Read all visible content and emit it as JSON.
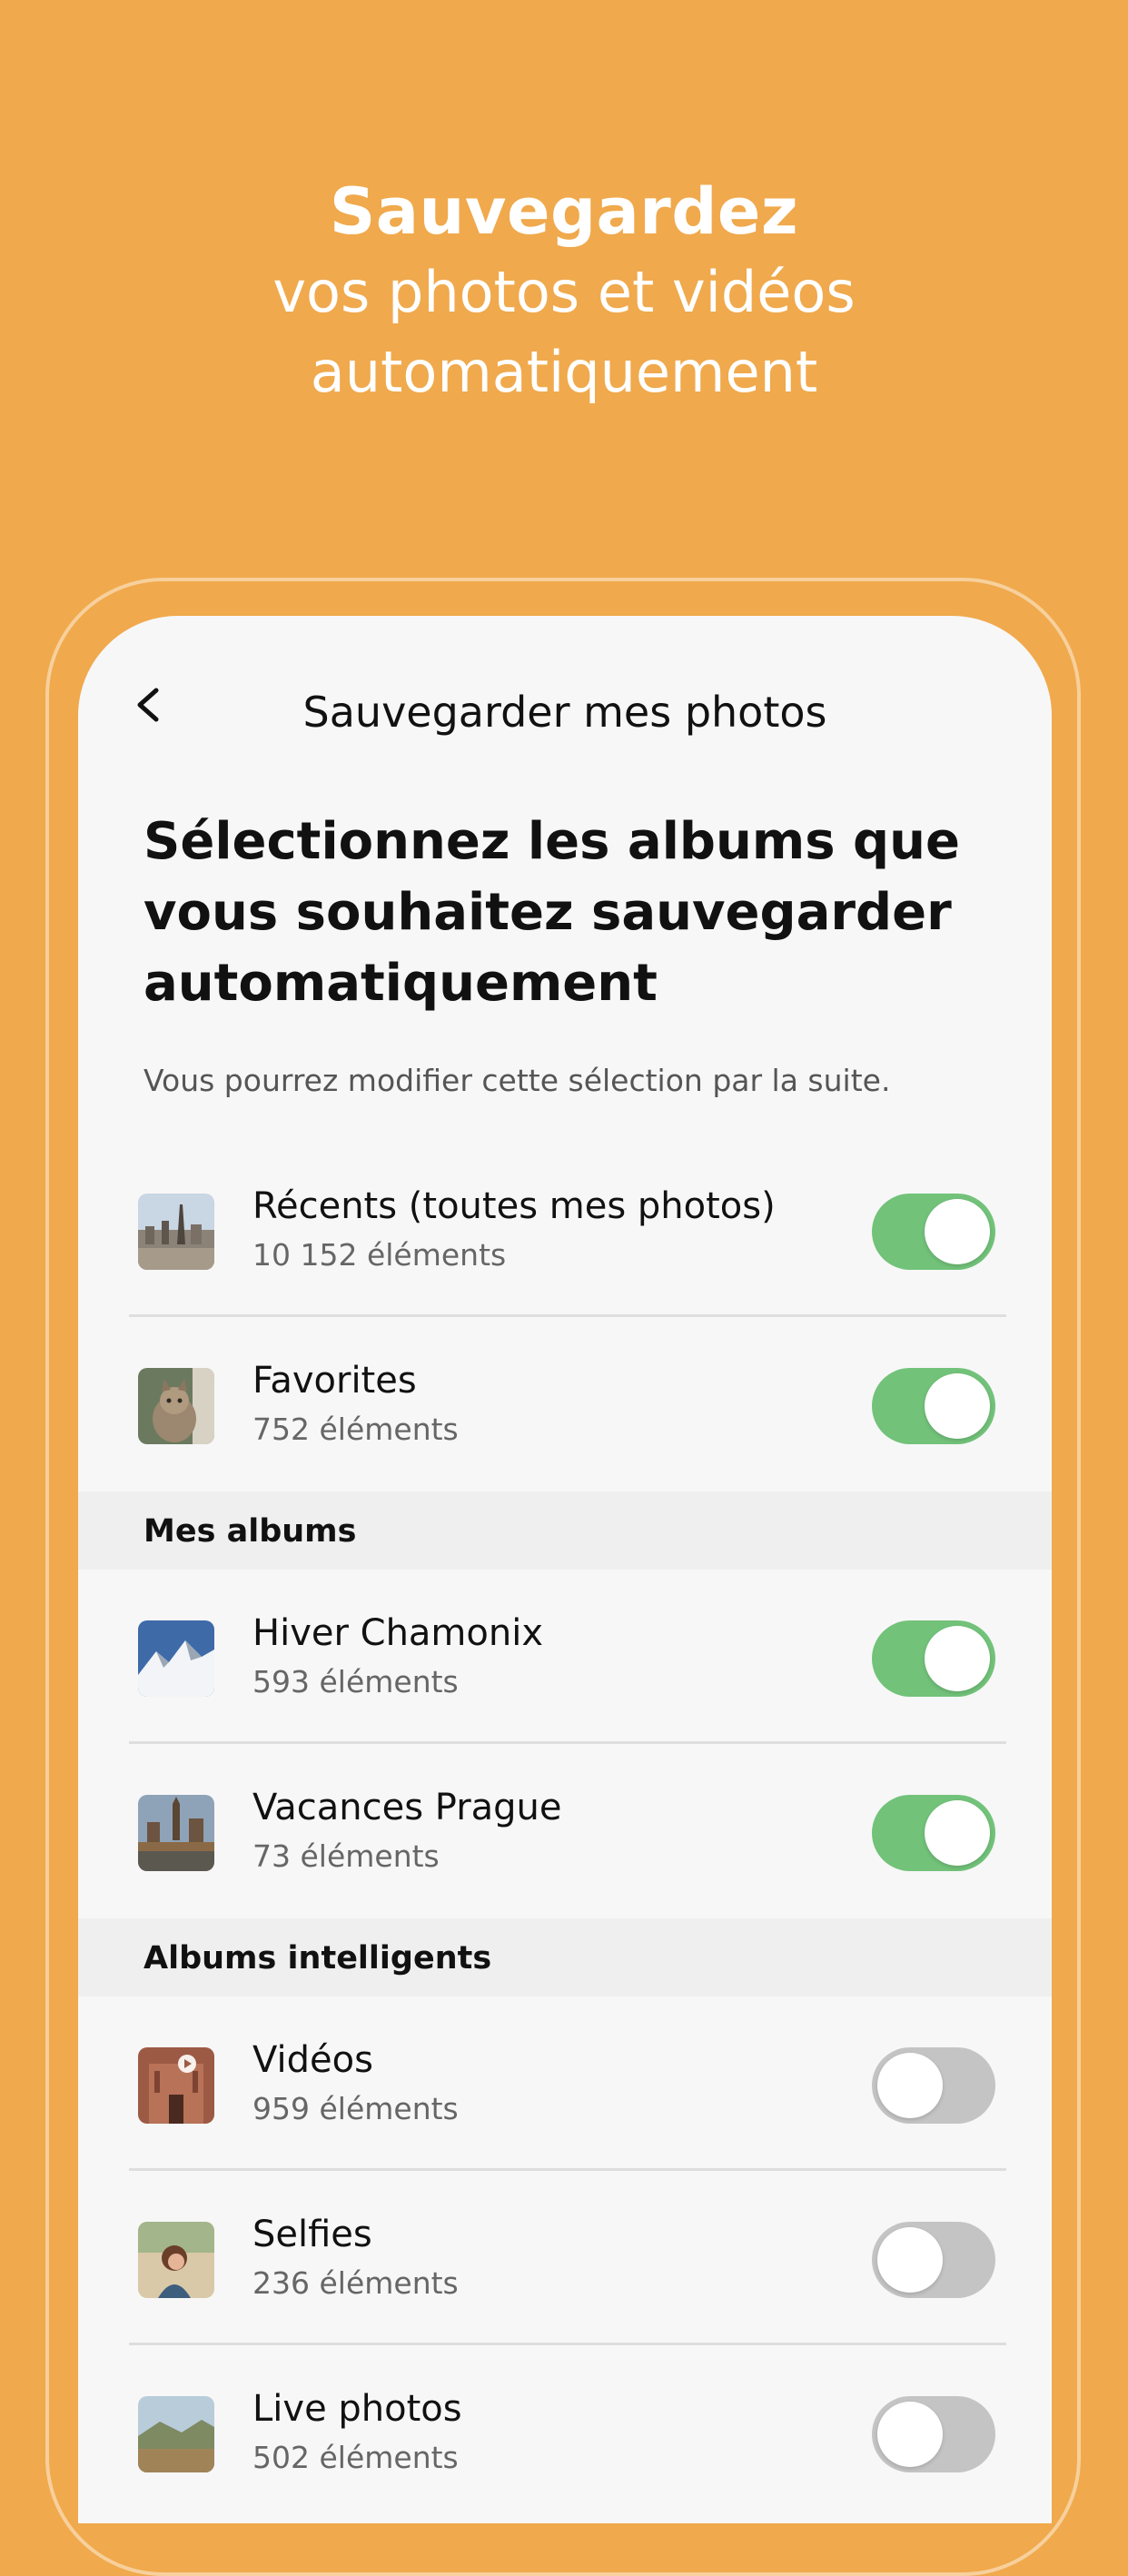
{
  "hero": {
    "title": "Sauvegardez",
    "subtitle_line1": "vos photos et vidéos",
    "subtitle_line2": "automatiquement"
  },
  "screen": {
    "nav_title": "Sauvegarder mes photos",
    "heading": "Sélectionnez les albums que vous souhaitez sauvegarder automatiquement",
    "subtitle": "Vous pourrez modifier cette sélection par la suite."
  },
  "albums": [
    {
      "title": "Récents (toutes mes photos)",
      "count": "10 152 éléments",
      "enabled": true
    },
    {
      "title": "Favorites",
      "count": "752 éléments",
      "enabled": true
    }
  ],
  "sections": {
    "my_albums": "Mes albums",
    "smart_albums": "Albums intelligents"
  },
  "my_albums": [
    {
      "title": "Hiver Chamonix",
      "count": "593 éléments",
      "enabled": true
    },
    {
      "title": "Vacances Prague",
      "count": "73 éléments",
      "enabled": true
    }
  ],
  "smart_albums": [
    {
      "title": "Vidéos",
      "count": "959 éléments",
      "enabled": false
    },
    {
      "title": "Selfies",
      "count": "236 éléments",
      "enabled": false
    },
    {
      "title": "Live photos",
      "count": "502 éléments",
      "enabled": false
    }
  ],
  "colors": {
    "background": "#F0A94C",
    "toggle_on": "#72C27A",
    "toggle_off": "#C4C4C4"
  }
}
